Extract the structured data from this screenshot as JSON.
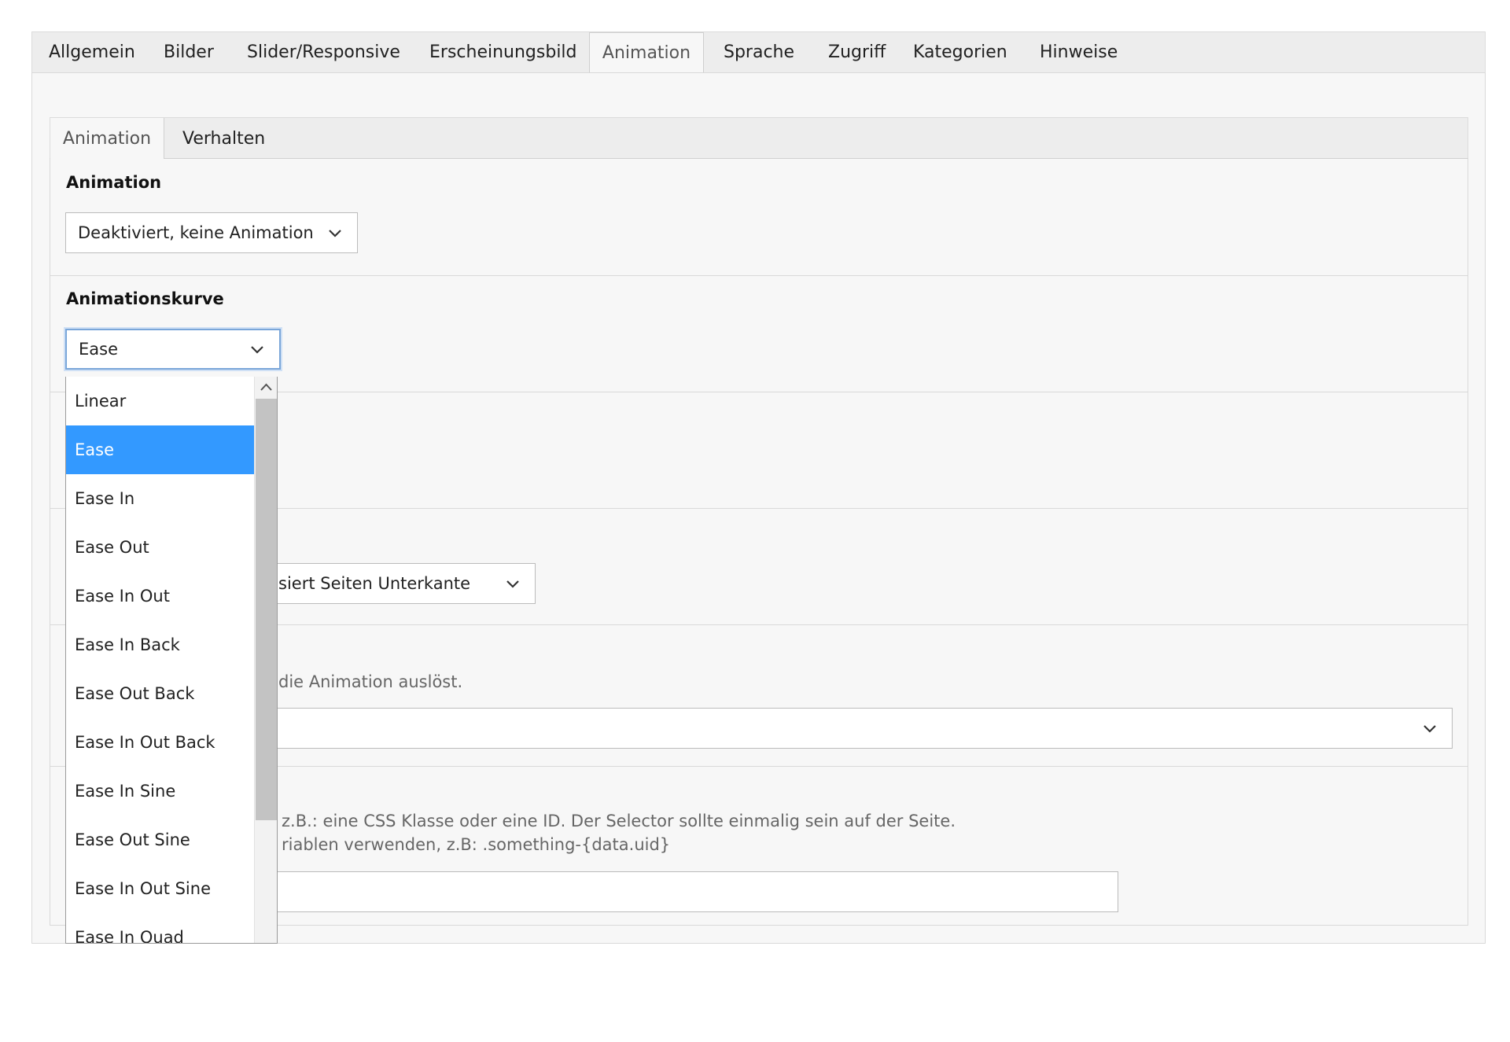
{
  "main_tabs": [
    {
      "label": "Allgemein"
    },
    {
      "label": "Bilder"
    },
    {
      "label": "Slider/Responsive"
    },
    {
      "label": "Erscheinungsbild"
    },
    {
      "label": "Animation"
    },
    {
      "label": "Sprache"
    },
    {
      "label": "Zugriff"
    },
    {
      "label": "Kategorien"
    },
    {
      "label": "Hinweise"
    }
  ],
  "active_main_tab": "Animation",
  "sub_tabs": [
    {
      "label": "Animation"
    },
    {
      "label": "Verhalten"
    }
  ],
  "active_sub_tab": "Animation",
  "fields": {
    "animation": {
      "label": "Animation",
      "value": "Deaktiviert, keine Animation"
    },
    "curve": {
      "label": "Animationskurve",
      "value": "Ease"
    },
    "trigger_select": {
      "value_partial": "siert Seiten Unterkante"
    },
    "element_help": "die Animation auslöst.",
    "selector_help_1": "z.B.: eine CSS Klasse oder eine ID. Der Selector sollte einmalig sein auf der Seite.",
    "selector_help_2": "riablen verwenden, z.B: .something-{data.uid}"
  },
  "dropdown": {
    "selected": "Ease",
    "options": [
      "Linear",
      "Ease",
      "Ease In",
      "Ease Out",
      "Ease In Out",
      "Ease In Back",
      "Ease Out Back",
      "Ease In Out Back",
      "Ease In Sine",
      "Ease Out Sine",
      "Ease In Out Sine",
      "Ease In Quad"
    ]
  },
  "colors": {
    "selected_option_bg": "#3399ff",
    "focus_border": "#7aa6d9"
  },
  "icons": {
    "select_arrow": "chevron-down-icon",
    "scroll_up": "chevron-up-icon"
  }
}
